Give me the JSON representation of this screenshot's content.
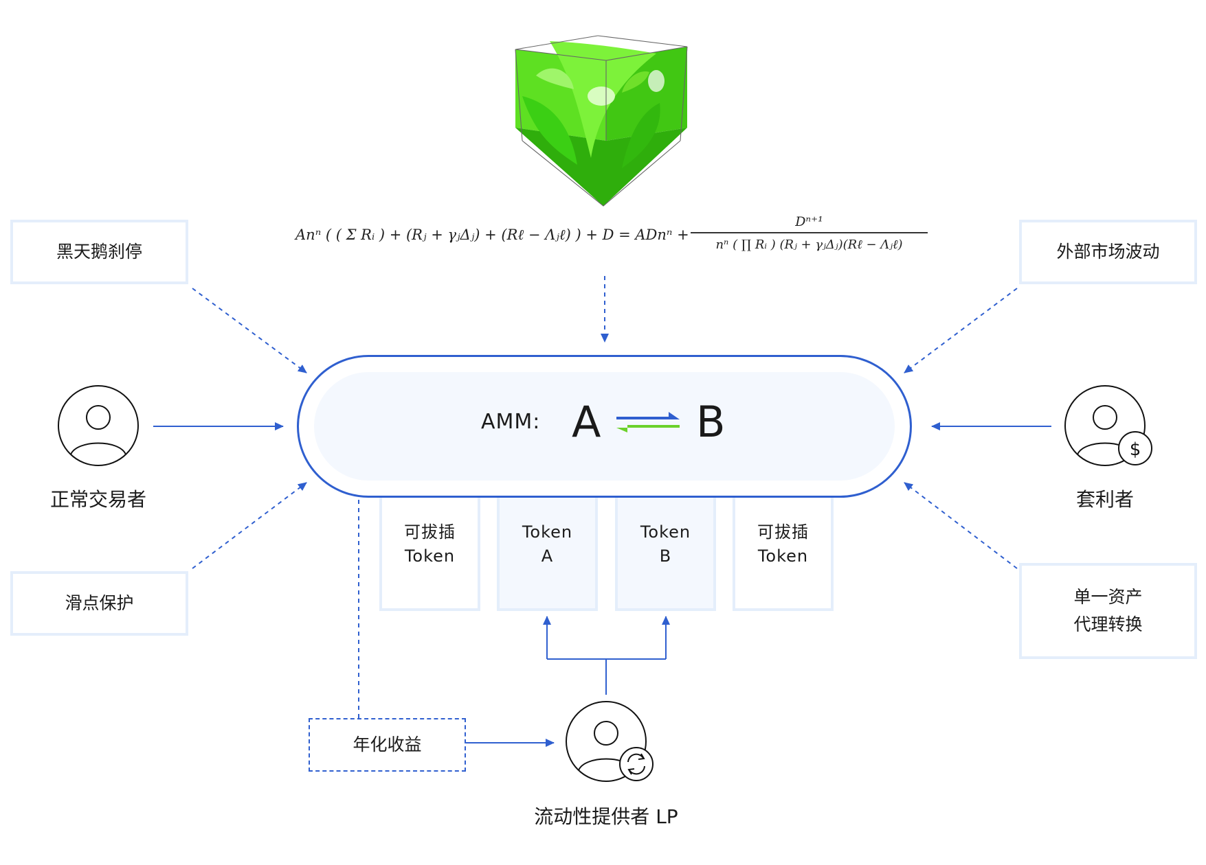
{
  "amm": {
    "label": "AMM:",
    "left_token": "A",
    "right_token": "B"
  },
  "risks": {
    "black_swan": "黑天鹅刹停",
    "slippage": "滑点保护",
    "market_volatility": "外部市场波动",
    "single_asset_line1": "单一资产",
    "single_asset_line2": "代理转换"
  },
  "actors": {
    "trader": "正常交易者",
    "arbitrageur": "套利者",
    "lp": "流动性提供者 LP"
  },
  "tokens": [
    {
      "line1": "可拔插",
      "line2": "Token"
    },
    {
      "line1": "Token",
      "line2": "A"
    },
    {
      "line1": "Token",
      "line2": "B"
    },
    {
      "line1": "可拔插",
      "line2": "Token"
    }
  ],
  "yield": "年化收益",
  "formula": {
    "lhs": "Anⁿ ( ( Σ Rᵢ ) + (Rⱼ + γⱼΔⱼ) + (Rℓ − Λⱼℓ) ) + D = ADnⁿ +",
    "numerator": "Dⁿ⁺¹",
    "denominator": "nⁿ ( ∏ Rᵢ ) (Rⱼ + γⱼΔⱼ)(Rℓ − Λⱼℓ)"
  },
  "icons": {
    "trader": "user-icon",
    "arbitrageur": "user-dollar-icon",
    "lp": "user-refresh-icon",
    "swap": "swap-arrows-icon",
    "surface": "green-3d-surface-icon"
  },
  "colors": {
    "accent": "#2f5fcf",
    "box_border": "#e4eefb",
    "green": "#6bd12b",
    "blue_arrow": "#2f5fcf"
  }
}
